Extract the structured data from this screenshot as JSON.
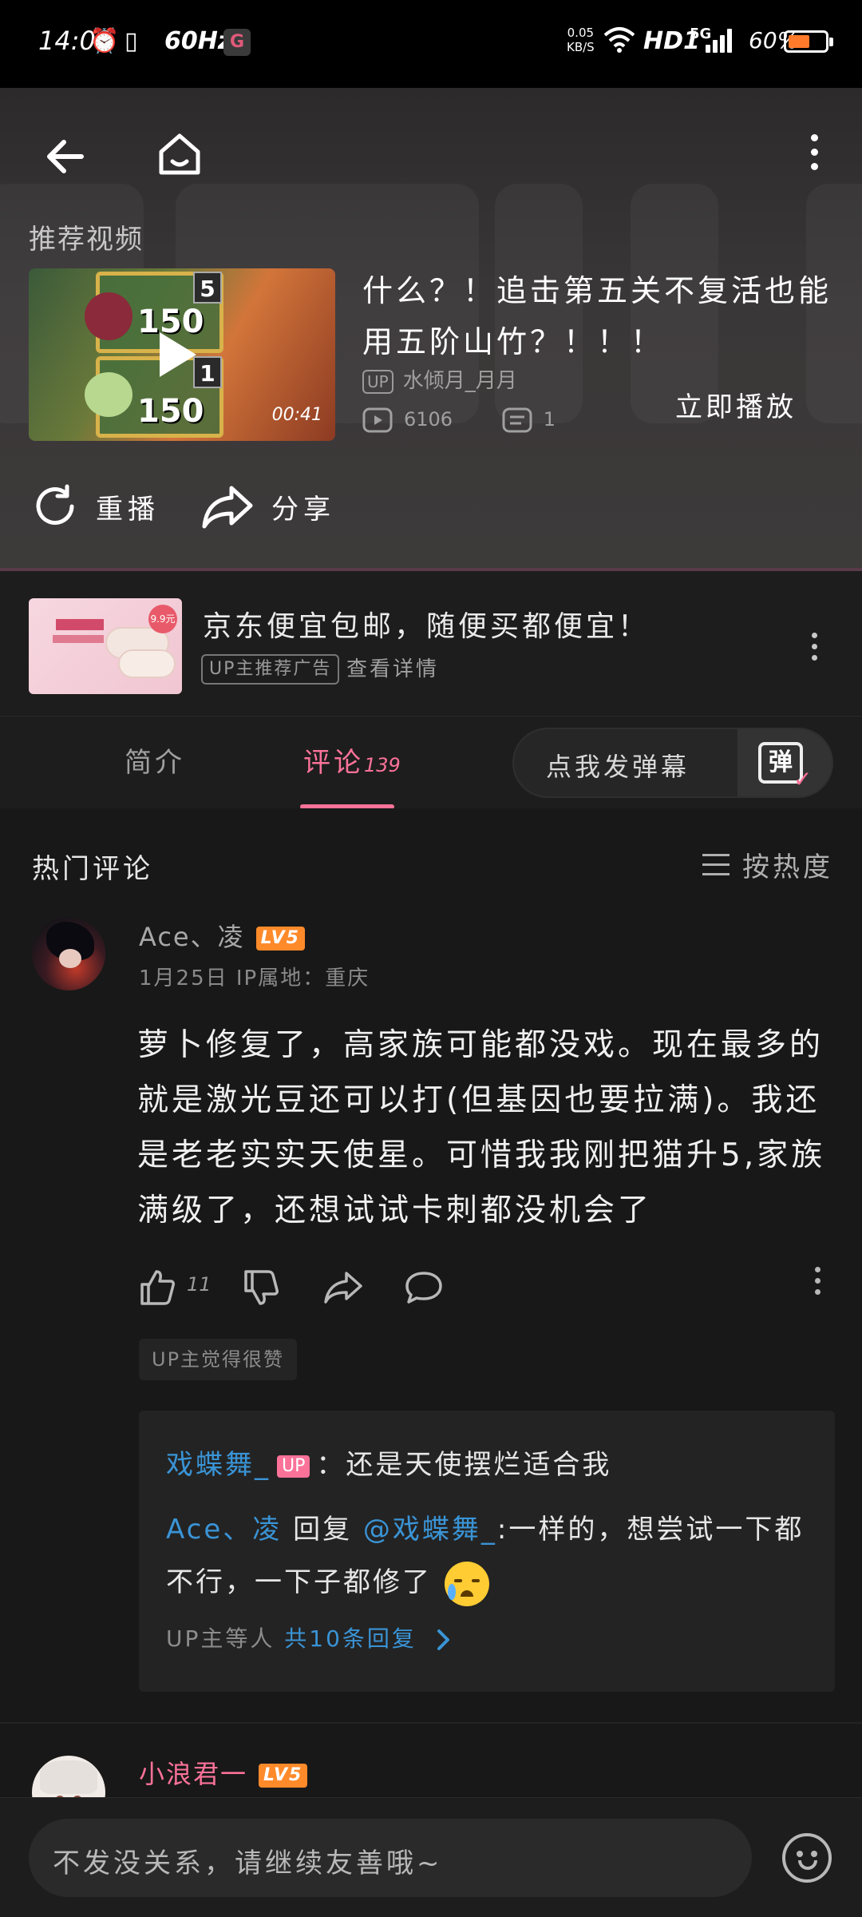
{
  "status_bar": {
    "time": "14:09",
    "refresh_rate": "60Hz",
    "net_speed_value": "0.05",
    "net_speed_unit": "KB/S",
    "hd": "HD1",
    "network": "5G",
    "battery_text": "60%",
    "battery_level": 0.6
  },
  "end_screen": {
    "recommended_label": "推荐视频",
    "video": {
      "title": "什么？！追击第五关不复活也能用五阶山竹？！！！",
      "duration": "00:41",
      "up_tag": "UP",
      "uploader": "水倾月_月月",
      "views": "6106",
      "danmaku_count": "1",
      "thumb_num1": "150",
      "thumb_num2": "150",
      "thumb_lvl1": "5",
      "thumb_lvl2": "1"
    },
    "play_now": "立即播放",
    "replay": "重播",
    "share": "分享"
  },
  "ad": {
    "title": "京东便宜包邮，随便买都便宜！",
    "tag": "UP主推荐广告",
    "detail": "查看详情",
    "price_badge": "9.9元"
  },
  "tabs": {
    "intro": "简介",
    "comments": "评论",
    "comments_count": "139",
    "danmaku_prompt": "点我发弹幕",
    "danmaku_glyph": "弹"
  },
  "comments": {
    "hot_title": "热门评论",
    "sort_label": "按热度",
    "items": [
      {
        "user": "Ace、凌",
        "level": "LV5",
        "meta": "1月25日  IP属地：重庆",
        "text": "萝卜修复了，高家族可能都没戏。现在最多的就是激光豆还可以打(但基因也要拉满)。我还是老老实实天使星。可惜我我刚把猫升5,家族满级了，还想试试卡刺都没机会了",
        "likes": "11",
        "up_liked": "UP主觉得很赞",
        "replies": {
          "r1_user": "戏蝶舞_",
          "r1_badge": "UP",
          "r1_text": "：还是天使摆烂适合我",
          "r2_user": "Ace、凌",
          "r2_reply_word": " 回复 ",
          "r2_mention": "@戏蝶舞_",
          "r2_text": ":一样的，想尝试一下都不行，一下子都修了",
          "summary_prefix": "UP主等人 ",
          "summary_link": "共10条回复"
        }
      },
      {
        "user": "小浪君一",
        "level": "LV5"
      }
    ]
  },
  "input": {
    "placeholder": "不发没关系，请继续友善哦~"
  },
  "colors": {
    "accent": "#fb7299",
    "link": "#3a94d6",
    "level_badge": "#ff8a2a",
    "battery": "#ff7a2a"
  }
}
